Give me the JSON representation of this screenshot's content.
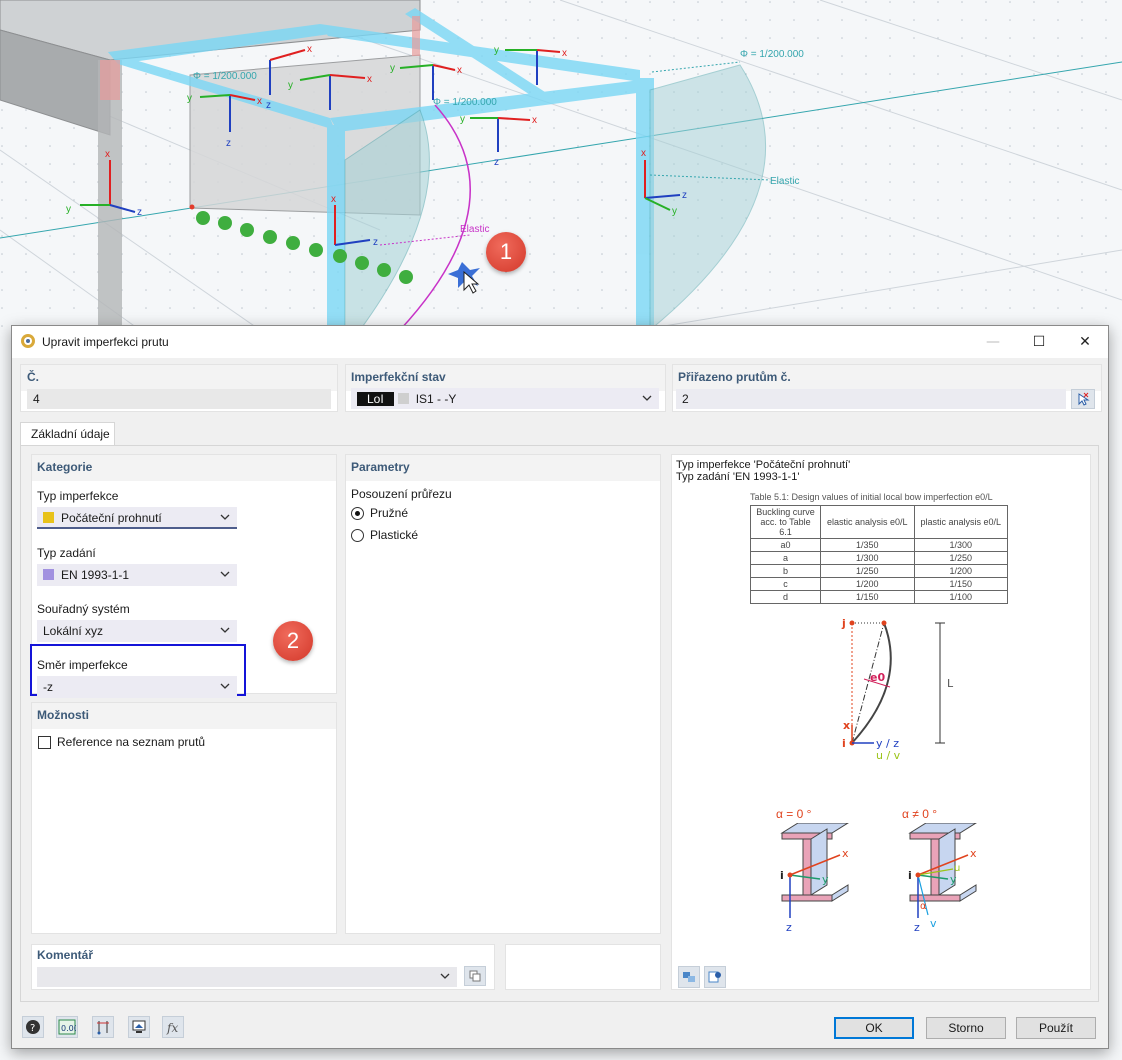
{
  "viewport": {
    "phi_labels": [
      "Φ = 1/200.000",
      "Φ = 1/200.000",
      "Φ = 1/200.000"
    ],
    "elastic_labels": [
      "Elastic",
      "Elastic"
    ],
    "axis_labels": {
      "x": "x",
      "y": "y",
      "z": "z"
    },
    "marker1": "1"
  },
  "dialog": {
    "title": "Upravit imperfekci prutu",
    "controls": {
      "minimize": "—",
      "maximize": "☐",
      "close": "✕"
    },
    "header": {
      "number_label": "Č.",
      "number_value": "4",
      "imperf_state_label": "Imperfekční stav",
      "imperf_state_tag": "LoI",
      "imperf_state_value": "IS1 - -Y",
      "assigned_label": "Přiřazeno prutům č.",
      "assigned_value": "2"
    },
    "tabs": [
      "Základní údaje"
    ],
    "category": {
      "section_label": "Kategorie",
      "type_label": "Typ imperfekce",
      "type_value": "Počáteční prohnutí",
      "type_color": "#e8c21a",
      "input_label": "Typ zadání",
      "input_value": "EN 1993-1-1",
      "input_color": "#a291e0",
      "cs_label": "Souřadný systém",
      "cs_value": "Lokální xyz",
      "dir_label": "Směr imperfekce",
      "dir_value": "-z"
    },
    "marker2": "2",
    "options": {
      "section_label": "Možnosti",
      "ref_label": "Reference na seznam prutů"
    },
    "params": {
      "section_label": "Parametry",
      "cross_label": "Posouzení průřezu",
      "elastic_label": "Pružné",
      "plastic_label": "Plastické"
    },
    "info": {
      "line1": "Typ imperfekce 'Počáteční prohnutí'",
      "line2": "Typ zadání 'EN 1993-1-1'",
      "table_title": "Table 5.1: Design values of initial local bow imperfection e0/L",
      "table_head": [
        "Buckling curve acc. to Table 6.1",
        "elastic analysis e0/L",
        "plastic analysis e0/L"
      ],
      "table_rows": [
        [
          "a0",
          "1/350",
          "1/300"
        ],
        [
          "a",
          "1/300",
          "1/250"
        ],
        [
          "b",
          "1/250",
          "1/200"
        ],
        [
          "c",
          "1/200",
          "1/150"
        ],
        [
          "d",
          "1/150",
          "1/100"
        ]
      ],
      "diagram": {
        "j": "j",
        "i": "i",
        "x": "x",
        "e0": "e0",
        "L": "L",
        "yz": "y / z",
        "uv": "u / v"
      },
      "alpha0": "α = 0 °",
      "alpha_ne0": "α ≠ 0 °",
      "profile_labels": {
        "x": "x",
        "y": "y",
        "z": "z",
        "i": "i",
        "u": "u",
        "v": "v",
        "alpha": "α"
      }
    },
    "comment": {
      "label": "Komentář"
    },
    "buttons": {
      "ok": "OK",
      "cancel": "Storno",
      "apply": "Použít"
    },
    "footer_tools": [
      "help-icon",
      "units-icon",
      "model-icon",
      "view-icon",
      "formula-icon"
    ]
  }
}
